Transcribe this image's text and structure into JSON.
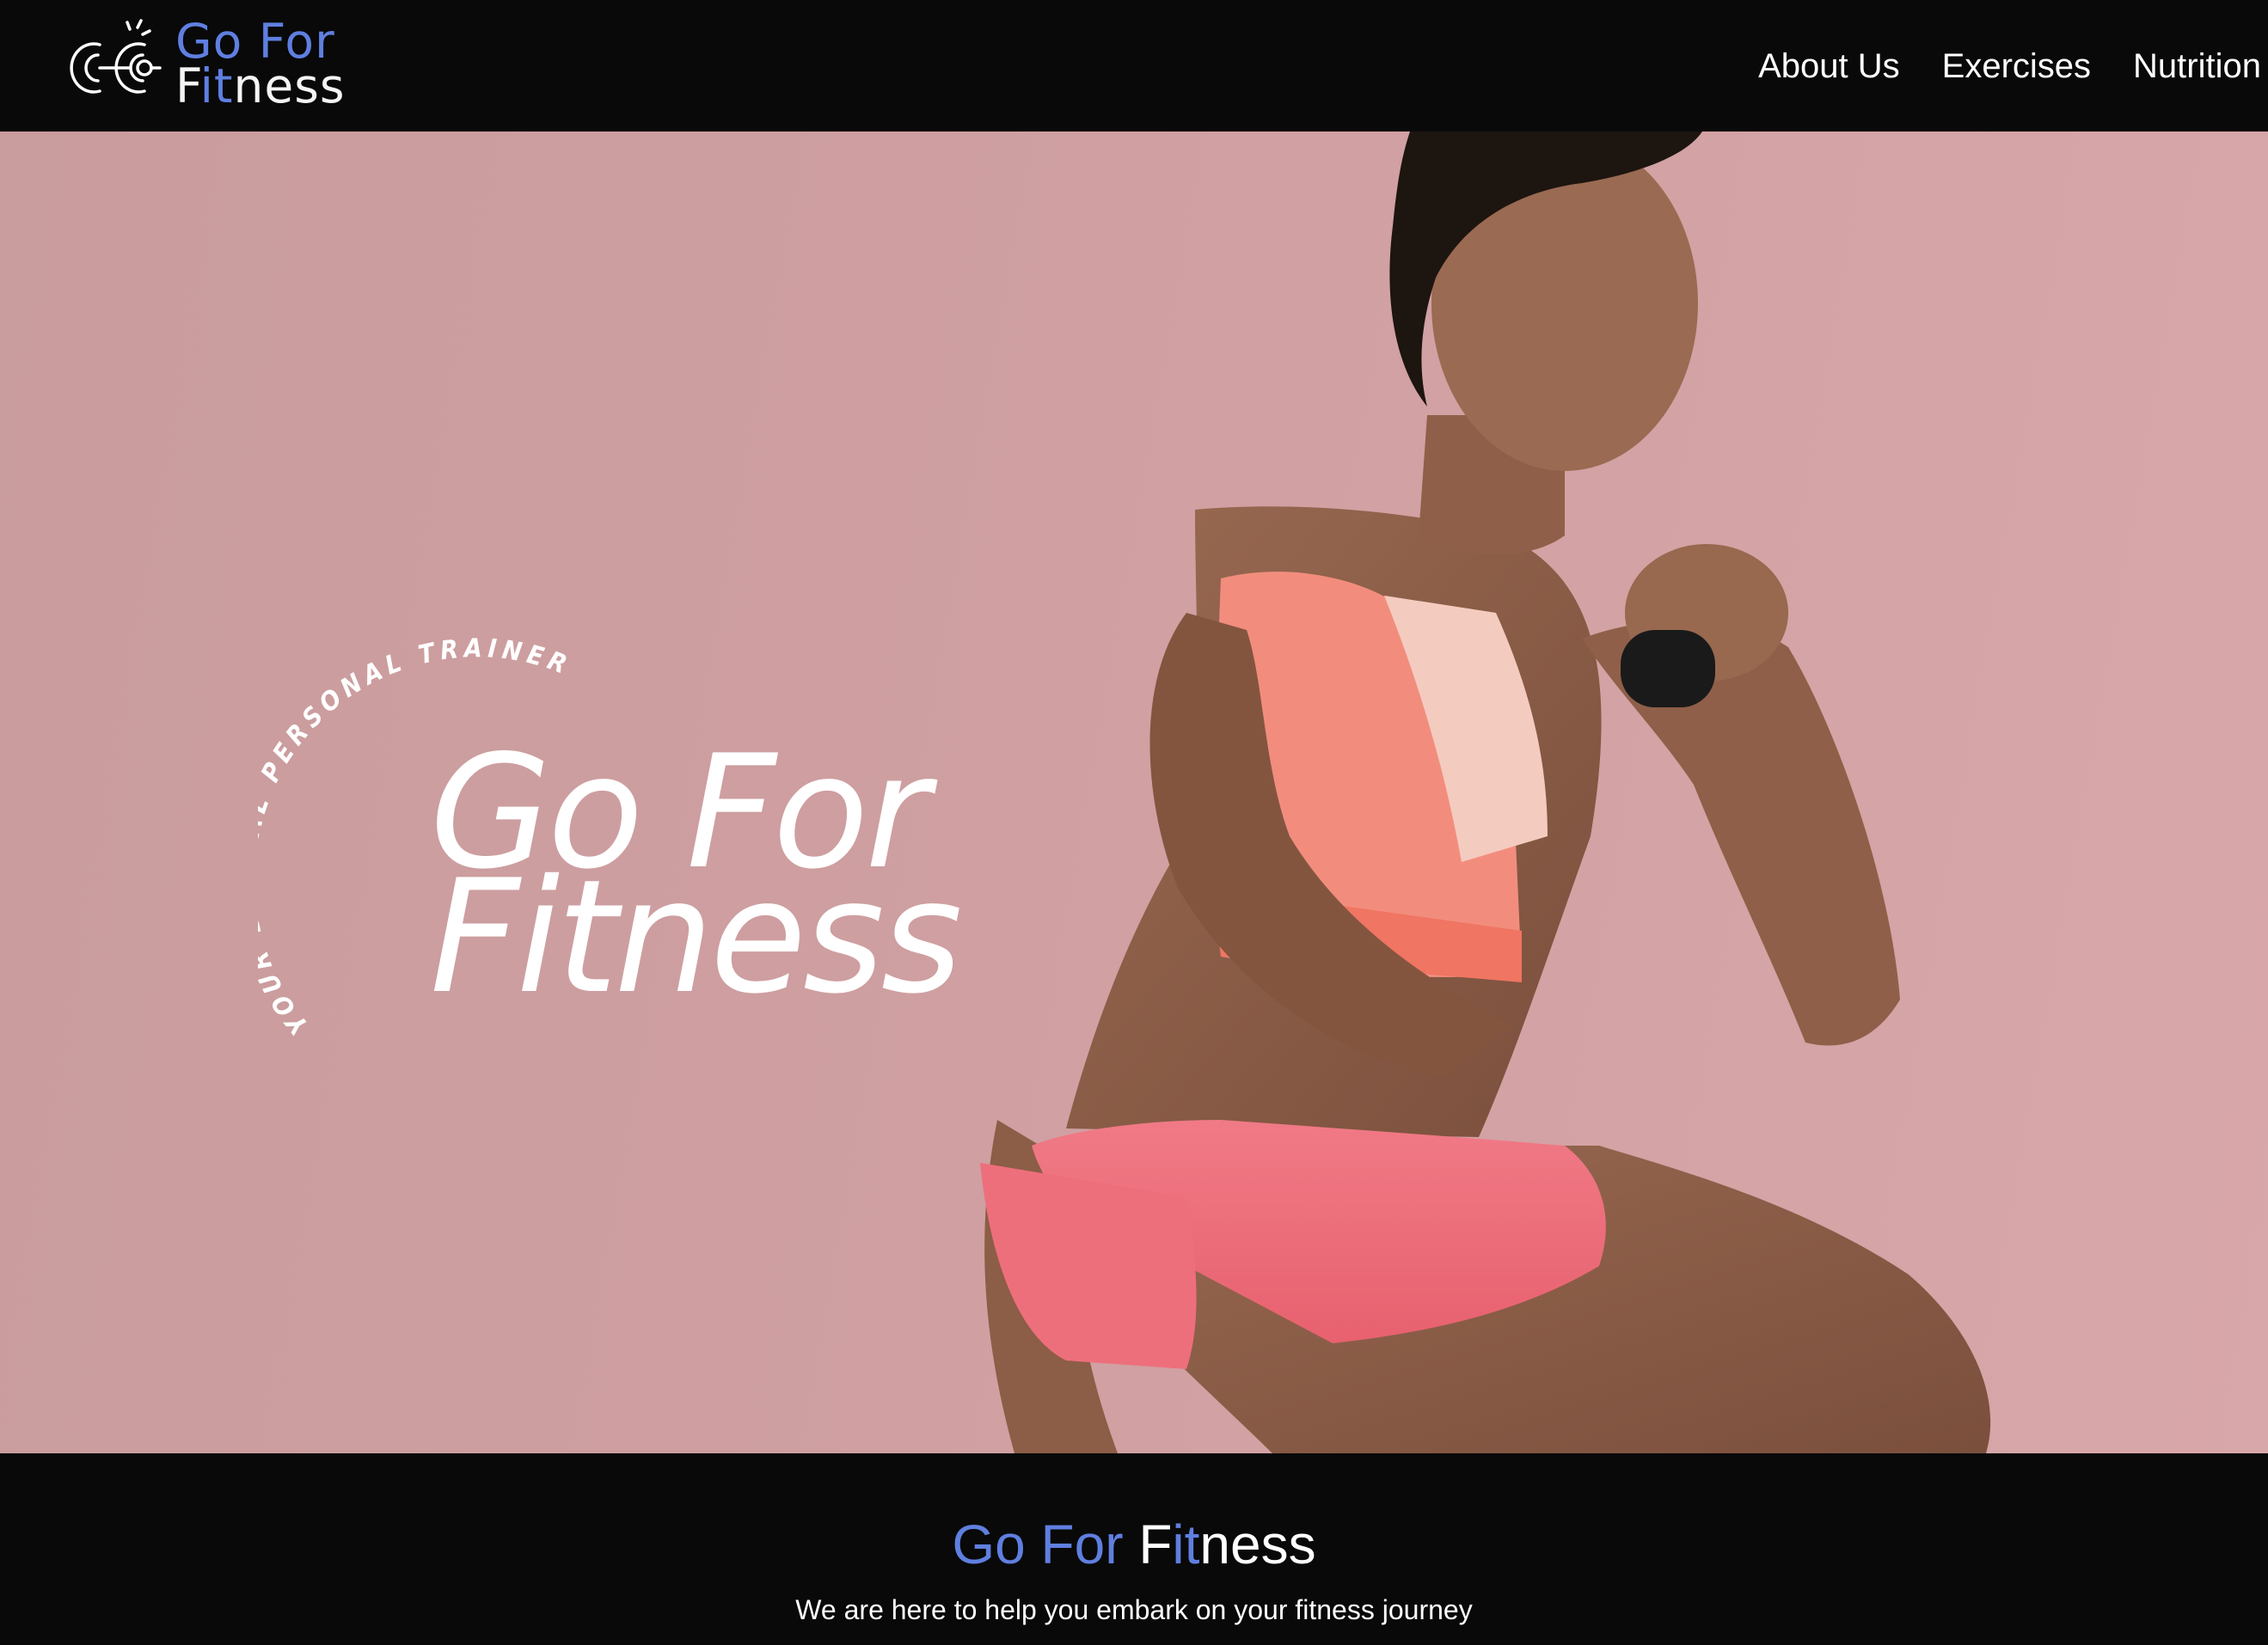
{
  "colors": {
    "accent": "#5f7fe0",
    "header_bg": "#090909",
    "hero_bg": "#cf9fa1",
    "text_light": "#ffffff"
  },
  "header": {
    "logo": {
      "icon": "dumbbell-icon",
      "line1": "Go For",
      "line2_a": "F",
      "line2_b": "it",
      "line2_c": "ness"
    },
    "nav": [
      {
        "label": "About Us"
      },
      {
        "label": "Exercises"
      },
      {
        "label": "Nutrition"
      }
    ]
  },
  "hero": {
    "arc_text": "YOUR DIGITAL PERSONAL TRAINER",
    "title_line1": "Go For",
    "title_line2": "Fitness",
    "image": "woman-squatting-photo"
  },
  "footer": {
    "title_part1": "Go For ",
    "title_part2a": "F",
    "title_part2b": "it",
    "title_part2c": "ness",
    "tagline": "We are here to help you embark on your fitness journey"
  }
}
